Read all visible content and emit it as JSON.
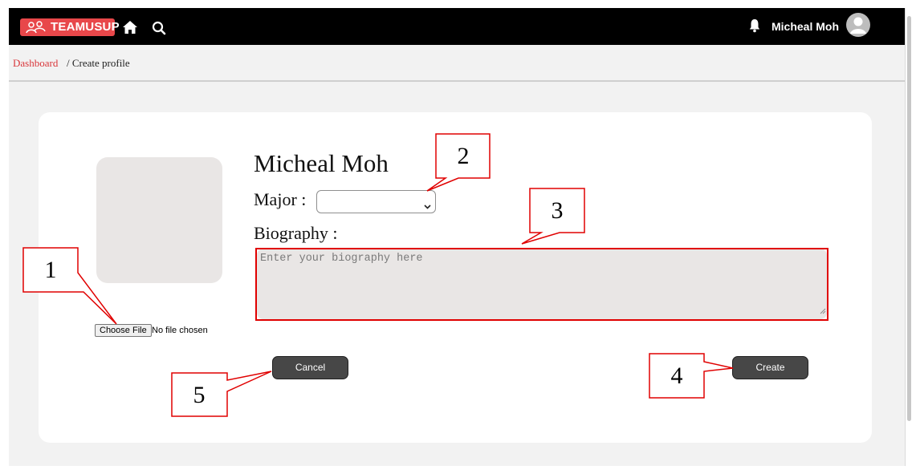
{
  "navbar": {
    "logo_text": "TEAMUSUP",
    "user_name": "Micheal Moh",
    "icons": [
      "teamusup-logo-icon",
      "home-icon",
      "search-icon",
      "bell-icon",
      "user-avatar-icon"
    ]
  },
  "breadcrumb": {
    "link": "Dashboard",
    "current": "/ Create profile"
  },
  "profile": {
    "name": "Micheal Moh",
    "photo": {
      "file_button": "Choose File",
      "file_status": "No file chosen"
    },
    "major": {
      "label": "Major :",
      "selected_value": ""
    },
    "biography": {
      "label": "Biography :",
      "value": "",
      "placeholder": "Enter your biography here"
    }
  },
  "actions": {
    "cancel_label": "Cancel",
    "create_label": "Create"
  },
  "callouts": [
    "1",
    "2",
    "3",
    "4",
    "5"
  ],
  "colors": {
    "navbar": "#000000",
    "brand": "#e8474a",
    "link": "#d9373b",
    "button": "#474747",
    "annotation": "#e00000"
  }
}
